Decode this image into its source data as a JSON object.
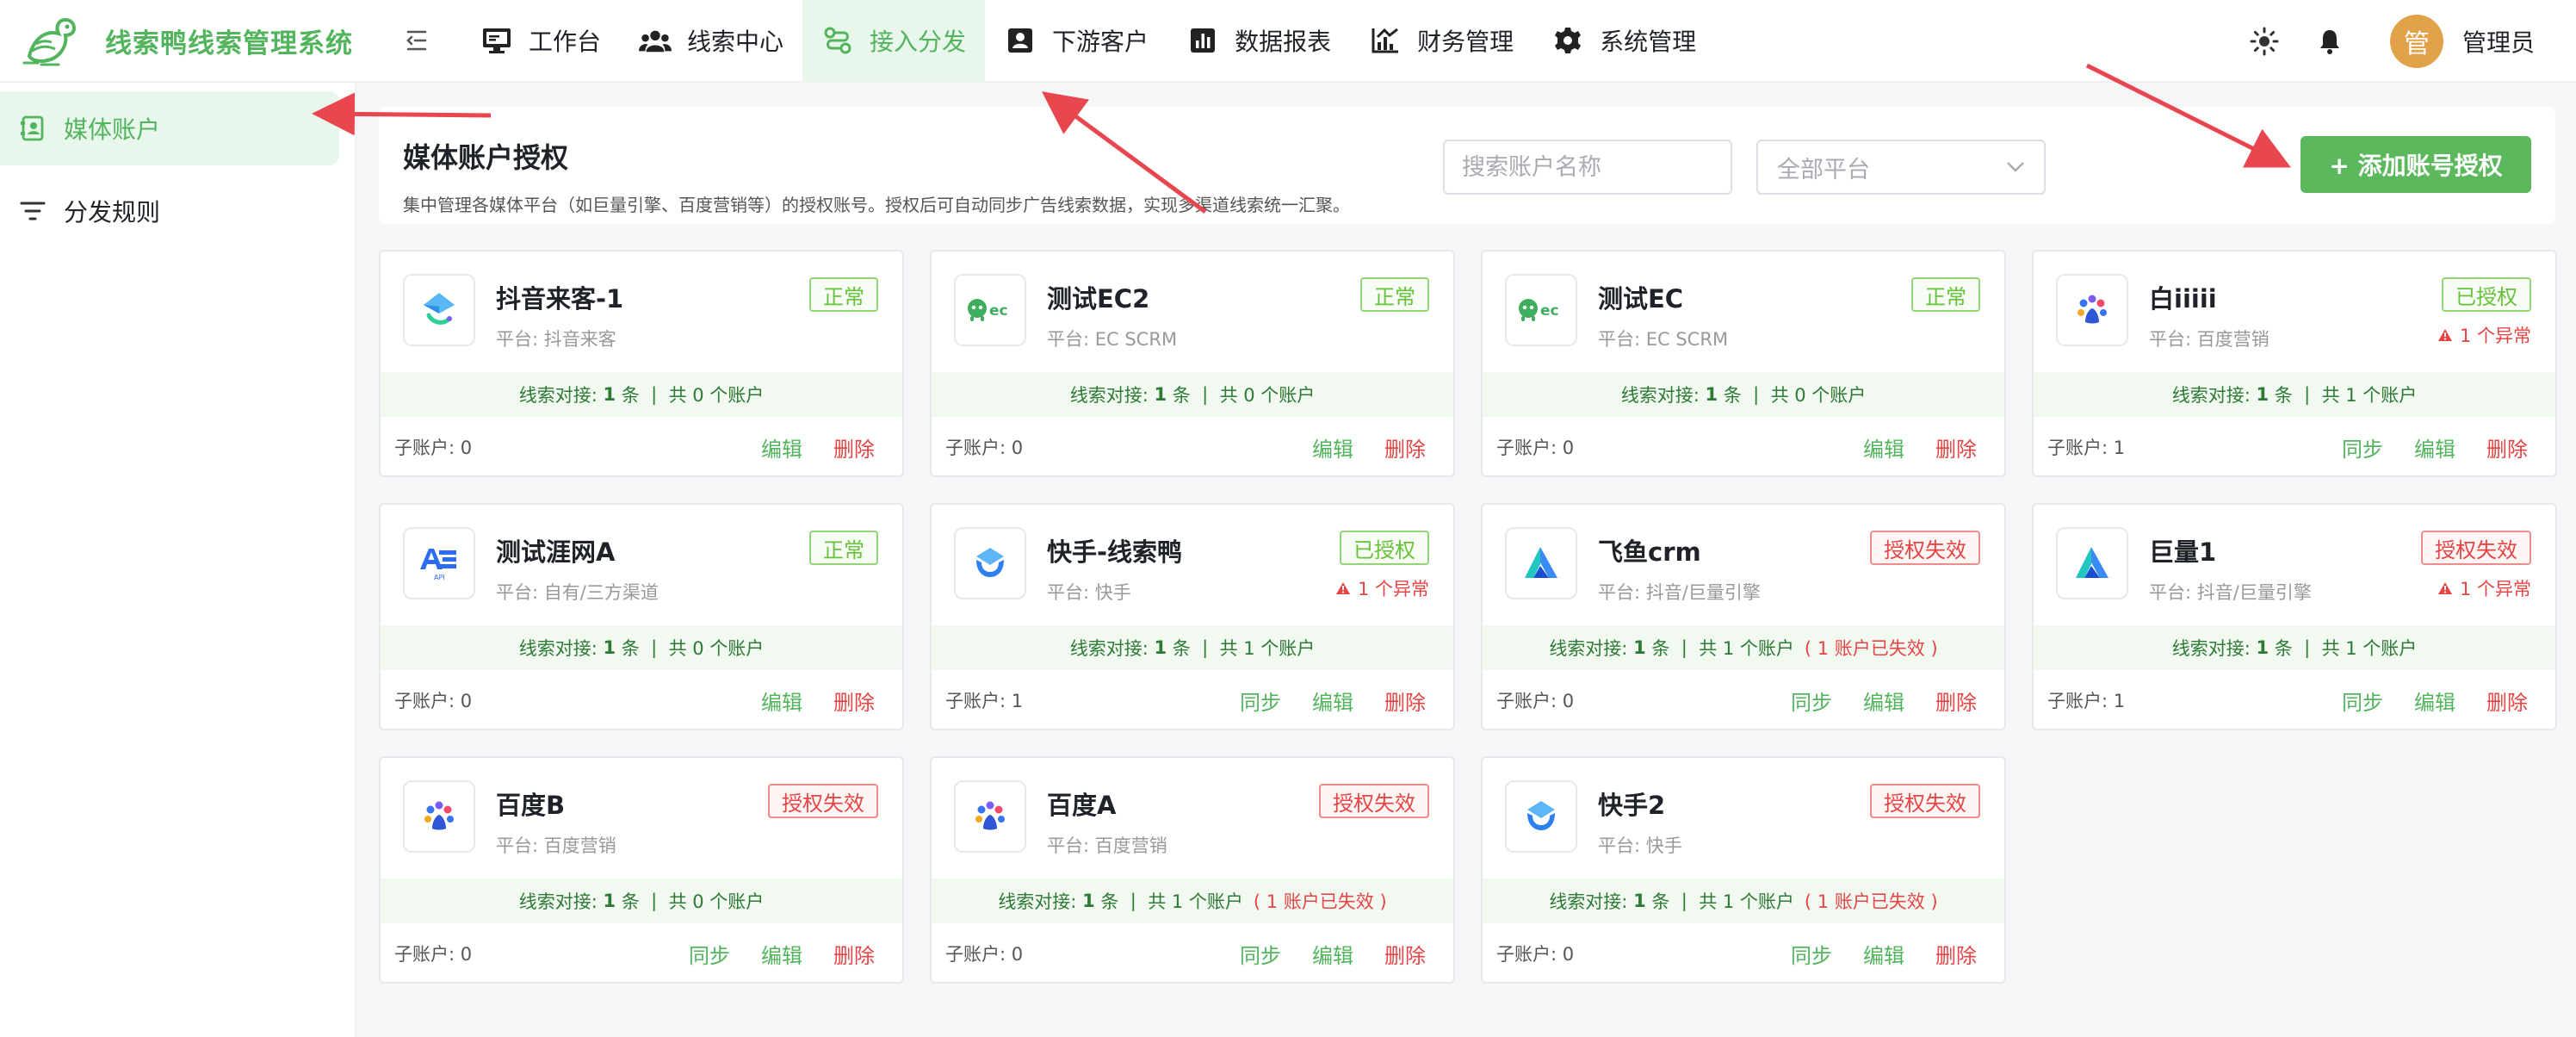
{
  "app": {
    "title": "线索鸭线索管理系统"
  },
  "nav": [
    {
      "label": "工作台",
      "icon": "monitor-icon",
      "active": false
    },
    {
      "label": "线索中心",
      "icon": "users-icon",
      "active": false
    },
    {
      "label": "接入分发",
      "icon": "route-icon",
      "active": true
    },
    {
      "label": "下游客户",
      "icon": "id-card-icon",
      "active": false
    },
    {
      "label": "数据报表",
      "icon": "bar-chart-icon",
      "active": false
    },
    {
      "label": "财务管理",
      "icon": "finance-chart-icon",
      "active": false
    },
    {
      "label": "系统管理",
      "icon": "gear-icon",
      "active": false
    }
  ],
  "header": {
    "avatar_text": "管",
    "user_name": "管理员"
  },
  "sidebar": {
    "items": [
      {
        "label": "媒体账户",
        "icon": "account-book-icon",
        "active": true
      },
      {
        "label": "分发规则",
        "icon": "filter-lines-icon",
        "active": false
      }
    ]
  },
  "toolbar": {
    "title": "媒体账户授权",
    "description": "集中管理各媒体平台（如巨量引擎、百度营销等）的授权账号。授权后可自动同步广告线索数据，实现多渠道线索统一汇聚。",
    "search_placeholder": "搜索账户名称",
    "platform_select": "全部平台",
    "add_button": "+ 添加账号授权"
  },
  "card_labels": {
    "strip_prefix": "线索对接:",
    "strip_unit": "条",
    "separator": "|",
    "sub_accounts_prefix": "子账户:",
    "sync": "同步",
    "edit": "编辑",
    "delete": "删除"
  },
  "cards": [
    {
      "name": "抖音来客-1",
      "platform": "平台: 抖音来客",
      "logo": "douyin-laike-logo",
      "status": "正常",
      "status_type": "ok",
      "abnormal": "",
      "leads": "1",
      "accounts": "共 0 个账户",
      "expired": "",
      "sub_accounts": "0",
      "sync": false
    },
    {
      "name": "测试EC2",
      "platform": "平台: EC SCRM",
      "logo": "ec-logo",
      "status": "正常",
      "status_type": "ok",
      "abnormal": "",
      "leads": "1",
      "accounts": "共 0 个账户",
      "expired": "",
      "sub_accounts": "0",
      "sync": false
    },
    {
      "name": "测试EC",
      "platform": "平台: EC SCRM",
      "logo": "ec-logo",
      "status": "正常",
      "status_type": "ok",
      "abnormal": "",
      "leads": "1",
      "accounts": "共 0 个账户",
      "expired": "",
      "sub_accounts": "0",
      "sync": false
    },
    {
      "name": "白iiiii",
      "platform": "平台: 百度营销",
      "logo": "baidu-logo",
      "status": "已授权",
      "status_type": "ok",
      "abnormal": "1 个异常",
      "leads": "1",
      "accounts": "共 1 个账户",
      "expired": "",
      "sub_accounts": "1",
      "sync": true
    },
    {
      "name": "测试涯网A",
      "platform": "平台: 自有/三方渠道",
      "logo": "api-logo",
      "status": "正常",
      "status_type": "ok",
      "abnormal": "",
      "leads": "1",
      "accounts": "共 0 个账户",
      "expired": "",
      "sub_accounts": "0",
      "sync": false
    },
    {
      "name": "快手-线索鸭",
      "platform": "平台: 快手",
      "logo": "kuaishou-logo",
      "status": "已授权",
      "status_type": "ok",
      "abnormal": "1 个异常",
      "leads": "1",
      "accounts": "共 1 个账户",
      "expired": "",
      "sub_accounts": "1",
      "sync": true
    },
    {
      "name": "飞鱼crm",
      "platform": "平台: 抖音/巨量引擎",
      "logo": "juliang-logo",
      "status": "授权失效",
      "status_type": "fail",
      "abnormal": "",
      "leads": "1",
      "accounts": "共 1 个账户",
      "expired": "( 1 账户已失效 )",
      "sub_accounts": "0",
      "sync": true
    },
    {
      "name": "巨量1",
      "platform": "平台: 抖音/巨量引擎",
      "logo": "juliang-logo",
      "status": "授权失效",
      "status_type": "fail",
      "abnormal": "1 个异常",
      "leads": "1",
      "accounts": "共 1 个账户",
      "expired": "",
      "sub_accounts": "1",
      "sync": true
    },
    {
      "name": "百度B",
      "platform": "平台: 百度营销",
      "logo": "baidu-logo",
      "status": "授权失效",
      "status_type": "fail",
      "abnormal": "",
      "leads": "1",
      "accounts": "共 0 个账户",
      "expired": "",
      "sub_accounts": "0",
      "sync": true
    },
    {
      "name": "百度A",
      "platform": "平台: 百度营销",
      "logo": "baidu-logo",
      "status": "授权失效",
      "status_type": "fail",
      "abnormal": "",
      "leads": "1",
      "accounts": "共 1 个账户",
      "expired": "( 1 账户已失效 )",
      "sub_accounts": "0",
      "sync": true
    },
    {
      "name": "快手2",
      "platform": "平台: 快手",
      "logo": "kuaishou-logo",
      "status": "授权失效",
      "status_type": "fail",
      "abnormal": "",
      "leads": "1",
      "accounts": "共 1 个账户",
      "expired": "( 1 账户已失效 )",
      "sub_accounts": "0",
      "sync": true
    }
  ],
  "colors": {
    "brand_green": "#52b55e",
    "button_green": "#5cb85c",
    "danger_red": "#e64545",
    "ok_green": "#67c23a",
    "strip_bg": "#f1f9f1",
    "annotation_arrow": "#e8474f"
  }
}
